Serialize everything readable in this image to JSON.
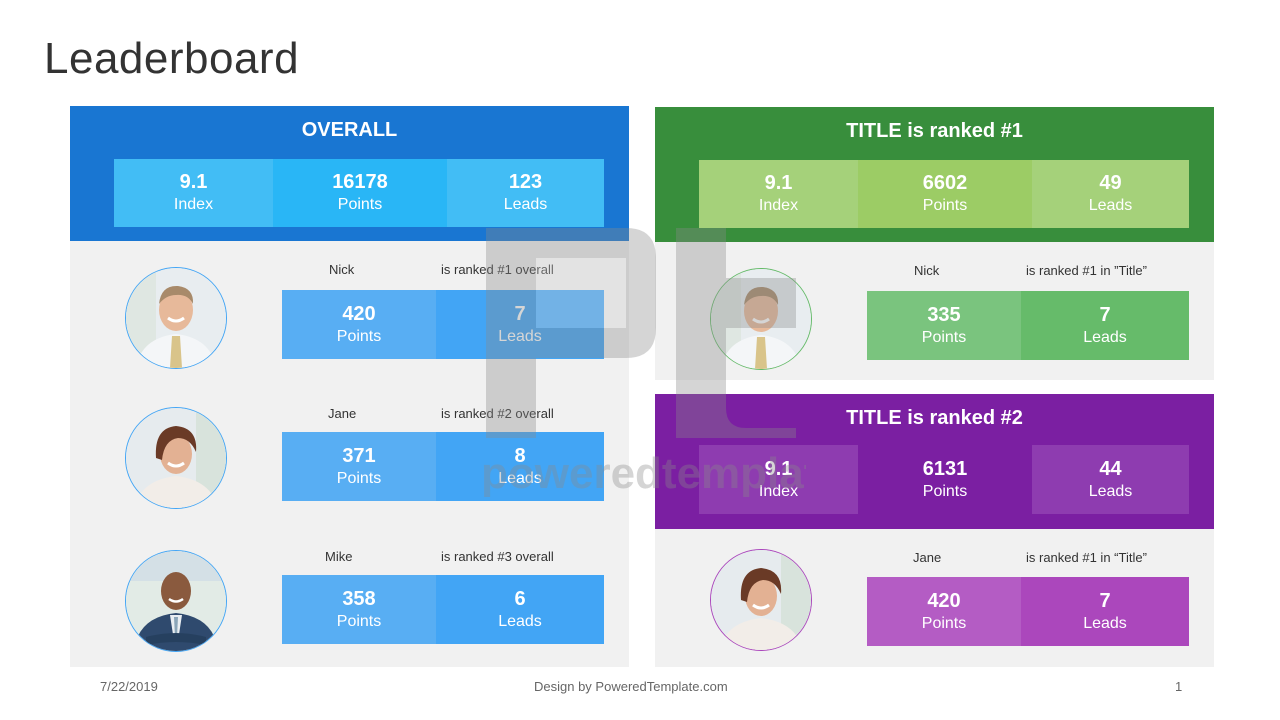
{
  "page": {
    "title": "Leaderboard"
  },
  "colors": {
    "overall_head": "#1976d2",
    "overall_cell_a": "#42bdf5",
    "overall_cell_b": "#29b6f6",
    "overall_mini_a": "#58aef3",
    "overall_mini_b": "#42a5f5",
    "overall_avatar_border": "#42a5f5",
    "green_head": "#388e3c",
    "green_cell_a": "#a5d17a",
    "green_cell_b": "#9ccc65",
    "green_mini_a": "#7ac47e",
    "green_mini_b": "#66bb6a",
    "green_avatar_border": "#66bb6a",
    "purple_head": "#7b1fa2",
    "purple_cell_a": "#8e3cb0",
    "purple_cell_b": "#7b1fa2",
    "purple_mini_a": "#b45cc4",
    "purple_mini_b": "#ab47bc",
    "purple_avatar_border": "#ab47bc"
  },
  "overall": {
    "title": "OVERALL",
    "stats": [
      {
        "value": "9.1",
        "label": "Index"
      },
      {
        "value": "16178",
        "label": "Points"
      },
      {
        "value": "123",
        "label": "Leads"
      }
    ],
    "people": [
      {
        "name": "Nick",
        "rank_text": "is ranked #1 overall",
        "avatar": "man-tie",
        "points": "420",
        "points_label": "Points",
        "leads": "7",
        "leads_label": "Leads"
      },
      {
        "name": "Jane",
        "rank_text": "is ranked #2 overall",
        "avatar": "woman",
        "points": "371",
        "points_label": "Points",
        "leads": "8",
        "leads_label": "Leads"
      },
      {
        "name": "Mike",
        "rank_text": "is ranked #3 overall",
        "avatar": "man-suit",
        "points": "358",
        "points_label": "Points",
        "leads": "6",
        "leads_label": "Leads"
      }
    ]
  },
  "title1": {
    "title": "TITLE is ranked #1",
    "stats": [
      {
        "value": "9.1",
        "label": "Index"
      },
      {
        "value": "6602",
        "label": "Points"
      },
      {
        "value": "49",
        "label": "Leads"
      }
    ],
    "person": {
      "name": "Nick",
      "rank_text": "is ranked #1 in ”Title”",
      "avatar": "man-tie",
      "points": "335",
      "points_label": "Points",
      "leads": "7",
      "leads_label": "Leads"
    }
  },
  "title2": {
    "title": "TITLE is ranked #2",
    "stats": [
      {
        "value": "9.1",
        "label": "Index"
      },
      {
        "value": "6131",
        "label": "Points"
      },
      {
        "value": "44",
        "label": "Leads"
      }
    ],
    "person": {
      "name": "Jane",
      "rank_text": "is ranked #1 in “Title”",
      "avatar": "woman",
      "points": "420",
      "points_label": "Points",
      "leads": "7",
      "leads_label": "Leads"
    }
  },
  "footer": {
    "date": "7/22/2019",
    "credit": "Design by PoweredTemplate.com",
    "page_number": "1"
  },
  "watermark": {
    "text": "poweredtemplate"
  }
}
